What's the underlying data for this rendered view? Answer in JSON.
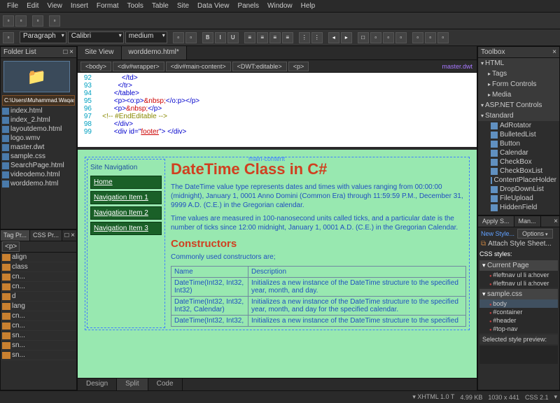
{
  "menu": [
    "File",
    "Edit",
    "View",
    "Insert",
    "Format",
    "Tools",
    "Table",
    "Site",
    "Data View",
    "Panels",
    "Window",
    "Help"
  ],
  "toolbar2": {
    "para": "Paragraph",
    "font": "Calibri",
    "size": "medium"
  },
  "folderList": {
    "title": "Folder List",
    "path": "C:\\Users\\Muhammad.Waqas\\Do",
    "files": [
      "index.html",
      "index_2.html",
      "layoutdemo.html",
      "logo.wmv",
      "master.dwt",
      "sample.css",
      "SearchPage.html",
      "videodemo.html",
      "worddemo.html"
    ]
  },
  "tagPanel": {
    "tab1": "Tag Pr...",
    "tab2": "CSS Pr...",
    "filter": "<p>",
    "rows": [
      "align",
      "class",
      "cn...",
      "cn...",
      "d",
      "lang",
      "cn...",
      "cn...",
      "sn...",
      "sn...",
      "sn..."
    ]
  },
  "docTabs": [
    "Site View",
    "worddemo.html*"
  ],
  "breadcrumb": [
    "<body>",
    "<div#wrapper>",
    "<div#main-content>",
    "<DWT:editable>",
    "<p>"
  ],
  "masterLink": "master.dwt",
  "code": [
    {
      "n": 92,
      "t": "</td>",
      "cls": "tag",
      "indent": 14
    },
    {
      "n": 93,
      "t": "</tr>",
      "cls": "tag",
      "indent": 12
    },
    {
      "n": 94,
      "t": "</table>",
      "cls": "tag",
      "indent": 10
    },
    {
      "n": 95,
      "raw": "<p><o:p>&nbsp;</o:p></p>",
      "indent": 10
    },
    {
      "n": 96,
      "raw": "<p>&nbsp;</p>",
      "indent": 10
    },
    {
      "n": 97,
      "t": "<!-- #EndEditable -->",
      "cls": "cmt",
      "indent": 4
    },
    {
      "n": 98,
      "t": "</div>",
      "cls": "tag",
      "indent": 10
    },
    {
      "n": 99,
      "raw": "<div id=\"footer\"> </div>",
      "indent": 10
    }
  ],
  "design": {
    "dwtLabel": "main-content",
    "siteNavTitle": "Site Navigation",
    "navItems": [
      "Home",
      "Navigation Item 1",
      "Navigation Item 2",
      "Navigation Item 3"
    ],
    "h1": "DateTime Class in C#",
    "p1": "The DateTime value type represents dates and times with values ranging from 00:00:00 (midnight), January 1, 0001 Anno Domini (Common Era) through 11:59:59 P.M., December 31, 9999 A.D. (C.E.) in the Gregorian calendar.",
    "p2": "Time values are measured in 100-nanosecond units called ticks, and a particular date is the number of ticks since 12:00 midnight, January 1, 0001 A.D. (C.E.) in the Gregorian Calendar.",
    "h2": "Constructors",
    "p3": "Commonly used constructors are;",
    "table": {
      "headers": [
        "Name",
        "Description"
      ],
      "rows": [
        [
          "DateTime(Int32, Int32, Int32)",
          "Initializes a new instance of the DateTime structure to the specified year, month, and day."
        ],
        [
          "DateTime(Int32, Int32, Int32, Calendar)",
          "Initializes a new instance of the DateTime structure to the specified year, month, and day for the specified calendar."
        ],
        [
          "DateTime(Int32, Int32,",
          "Initializes a new instance of the DateTime structure to the specified"
        ]
      ]
    }
  },
  "viewTabs": [
    "Design",
    "Split",
    "Code"
  ],
  "toolbox": {
    "title": "Toolbox",
    "groups": [
      {
        "name": "HTML",
        "open": true,
        "sub": [
          "Tags",
          "Form Controls",
          "Media"
        ]
      },
      {
        "name": "ASP.NET Controls",
        "open": true,
        "sub": []
      },
      {
        "name": "Standard",
        "open": true,
        "items": [
          "AdRotator",
          "BulletedList",
          "Button",
          "Calendar",
          "CheckBox",
          "CheckBoxList",
          "ContentPlaceHolder",
          "DropDownList",
          "FileUpload",
          "HiddenField"
        ]
      }
    ]
  },
  "styles": {
    "tab1": "Apply S...",
    "tab2": "Man...",
    "newStyle": "New Style...",
    "options": "Options",
    "attach": "Attach Style Sheet...",
    "cssStylesLabel": "CSS styles:",
    "currentPage": "Current Page",
    "pageRules": [
      "#leftnav ul li a:hover",
      "#leftnav ul li a:hover"
    ],
    "sheet": "sample.css",
    "sheetRules": [
      "body",
      "#container",
      "#header",
      "#top-nav"
    ],
    "previewLabel": "Selected style preview:"
  },
  "status": {
    "xhtml": "XHTML 1.0 T",
    "size": "4.99 KB",
    "dim": "1030 x 441",
    "css": "CSS 2.1"
  }
}
